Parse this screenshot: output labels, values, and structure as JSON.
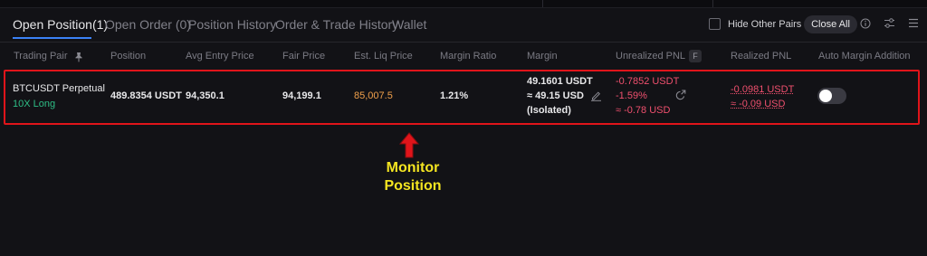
{
  "tabs": [
    {
      "label": "Open Position(1)",
      "active": true
    },
    {
      "label": "Open Order (0)",
      "active": false
    },
    {
      "label": "Position History",
      "active": false
    },
    {
      "label": "Order & Trade History",
      "active": false
    },
    {
      "label": "Wallet",
      "active": false
    }
  ],
  "toolbar": {
    "hide_other_pairs_label": "Hide Other Pairs",
    "hide_other_pairs_checked": false,
    "close_all_label": "Close All",
    "icons": [
      "info-icon",
      "settings-sliders-icon",
      "menu-icon"
    ]
  },
  "table": {
    "headers": {
      "pair": "Trading Pair",
      "position": "Position",
      "entry": "Avg Entry Price",
      "fair": "Fair Price",
      "liq": "Est. Liq Price",
      "ratio": "Margin Ratio",
      "margin": "Margin",
      "upnl": "Unrealized PNL",
      "upnl_badge": "F",
      "rpnl": "Realized PNL",
      "auto": "Auto Margin Addition"
    },
    "row": {
      "pair": "BTCUSDT Perpetual",
      "leverage_side": "10X Long",
      "position": "489.8354 USDT",
      "entry": "94,350.1",
      "fair": "94,199.1",
      "liq": "85,007.5",
      "ratio": "1.21%",
      "margin_line1": "49.1601 USDT",
      "margin_line2": "≈ 49.15 USD",
      "margin_line3": "(Isolated)",
      "upnl_line1": "-0.7852 USDT",
      "upnl_line2": "-1.59%",
      "upnl_line3": "≈ -0.78 USD",
      "rpnl_line1": "-0.0981 USDT",
      "rpnl_line2": "≈ -0.09 USD",
      "auto_margin_enabled": false
    }
  },
  "annotation": {
    "label_line1": "Monitor",
    "label_line2": "Position",
    "color": "#f4e521",
    "highlight_color": "#e0141a"
  },
  "colors": {
    "background": "#121216",
    "accent": "#3b82f6",
    "positive": "#2ebd85",
    "negative": "#f0506e",
    "liq_price": "#f0a04b"
  }
}
